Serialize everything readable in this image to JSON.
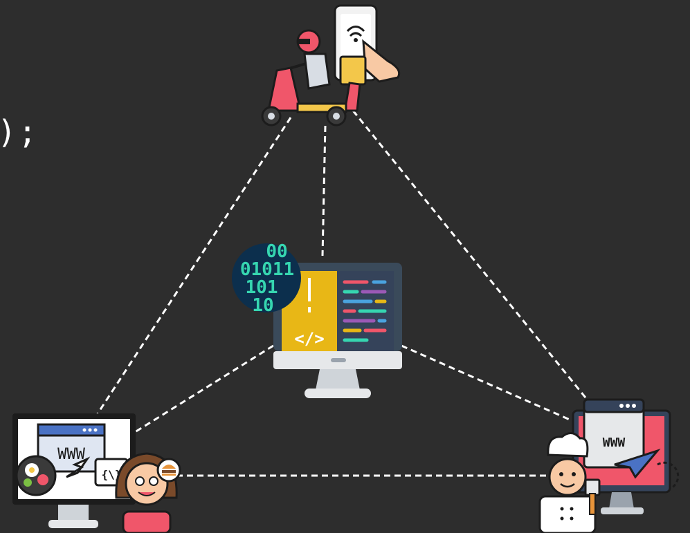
{
  "code_fragment": ");",
  "links": [
    {
      "from": "delivery-rider",
      "to": "dev-server"
    },
    {
      "from": "delivery-rider",
      "to": "customer-site"
    },
    {
      "from": "delivery-rider",
      "to": "restaurant-site"
    },
    {
      "from": "dev-server",
      "to": "customer-site"
    },
    {
      "from": "dev-server",
      "to": "restaurant-site"
    },
    {
      "from": "customer-site",
      "to": "restaurant-site"
    }
  ],
  "nodes": {
    "delivery_rider": {
      "icon": "delivery-scooter-icon"
    },
    "dev_server": {
      "icon": "developer-monitor-icon",
      "binary_lines": [
        "00",
        "01011",
        "101",
        "10"
      ]
    },
    "customer_site": {
      "icon": "customer-website-icon",
      "url_text": "WWW"
    },
    "restaurant_site": {
      "icon": "chef-website-icon",
      "url_text": "WWW"
    }
  },
  "colors": {
    "background": "#2d2d2d",
    "links": "#ffffff",
    "binary_bg": "#0c2f4d",
    "binary_text": "#36d6b0",
    "code_panel": "#e8b716",
    "brand_red": "#f0566a"
  }
}
